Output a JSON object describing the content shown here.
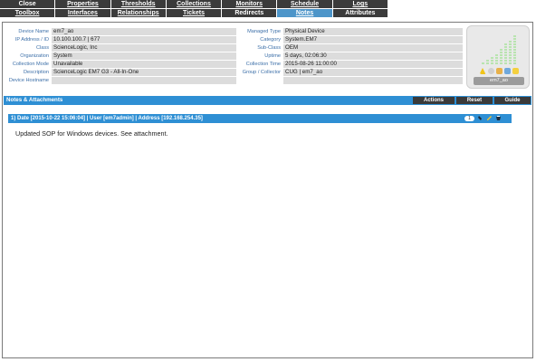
{
  "tabs": {
    "row1": [
      "Close",
      "Properties",
      "Thresholds",
      "Collections",
      "Monitors",
      "Schedule",
      "Logs"
    ],
    "row2": [
      "Toolbox",
      "Interfaces",
      "Relationships",
      "Tickets",
      "Redirects",
      "Notes",
      "Attributes"
    ],
    "active": "Notes"
  },
  "device": {
    "left": [
      {
        "label": "Device Name",
        "value": "em7_ao"
      },
      {
        "label": "IP Address / ID",
        "value": "10.100.100.7 | 677"
      },
      {
        "label": "Class",
        "value": "ScienceLogic, Inc"
      },
      {
        "label": "Organization",
        "value": "System"
      },
      {
        "label": "Collection Mode",
        "value": "Unavailable"
      },
      {
        "label": "Description",
        "value": "ScienceLogic EM7 G3 - All-In-One"
      },
      {
        "label": "Device Hostname",
        "value": ""
      }
    ],
    "right": [
      {
        "label": "Managed Type",
        "value": "Physical Device"
      },
      {
        "label": "Category",
        "value": "System.EM7"
      },
      {
        "label": "Sub-Class",
        "value": "OEM"
      },
      {
        "label": "Uptime",
        "value": "5 days, 02:06:30"
      },
      {
        "label": "Collection Time",
        "value": "2015-08-26 11:00:00"
      },
      {
        "label": "Group / Collector",
        "value": "CUG | em7_ao"
      }
    ],
    "card_name": "em7_ao"
  },
  "notes": {
    "header": "Notes & Attachments",
    "buttons": [
      "Actions",
      "Reset",
      "Guide"
    ],
    "entry_title": "1)  Date [2015-10-22 15:06:04] | User [em7admin] | Address [192.168.254.35]",
    "entry_count": "1",
    "entry_text": "Updated SOP for Windows devices. See attachment."
  }
}
